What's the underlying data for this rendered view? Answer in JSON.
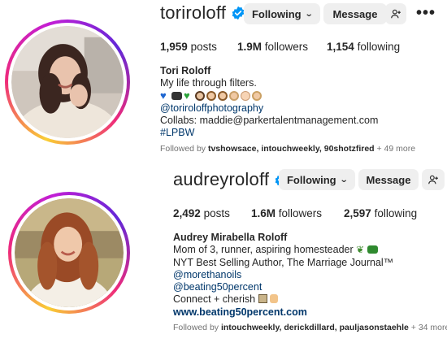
{
  "profiles": [
    {
      "username": "toriroloff",
      "following_label": "Following",
      "message_label": "Message",
      "more_label": "•••",
      "stats": {
        "posts": "1,959",
        "posts_label": "posts",
        "followers": "1.9M",
        "followers_label": "followers",
        "following": "1,154",
        "following_label": "following"
      },
      "bio": {
        "name": "Tori Roloff",
        "tagline": "My life through filters.",
        "emoji_row": [
          "blue-heart",
          "camera",
          "green-heart",
          "woman",
          "boy",
          "boy",
          "boy",
          "baby",
          "woman"
        ],
        "link1": "@toriroloffphotography",
        "collabs": "Collabs: maddie@parkertalentmanagement.com",
        "hashtag": "#LPBW"
      },
      "followed_prefix": "Followed by",
      "followed_names": "tvshowsace, intouchweekly, 90shotzfired",
      "followed_suffix": "+ 49 more"
    },
    {
      "username": "audreyroloff",
      "following_label": "Following",
      "message_label": "Message",
      "stats": {
        "posts": "2,492",
        "posts_label": "posts",
        "followers": "1.6M",
        "followers_label": "followers",
        "following": "2,597",
        "following_label": "following"
      },
      "bio": {
        "name": "Audrey Mirabella Roloff",
        "line1": "Mom of 3, runner, aspiring homesteader",
        "line2": "NYT Best Selling Author, The Marriage Journal™",
        "link1": "@morethanoils",
        "link2": "@beating50percent",
        "line3": "Connect + cherish",
        "website": "www.beating50percent.com"
      },
      "followed_prefix": "Followed by",
      "followed_names": "intouchweekly, derickdillard, pauljasonstaehle",
      "followed_suffix": "+ 34 more"
    }
  ],
  "colors": {
    "verified": "#0095f6",
    "link": "#00376b",
    "button_bg": "#efefef",
    "muted": "#737373"
  }
}
